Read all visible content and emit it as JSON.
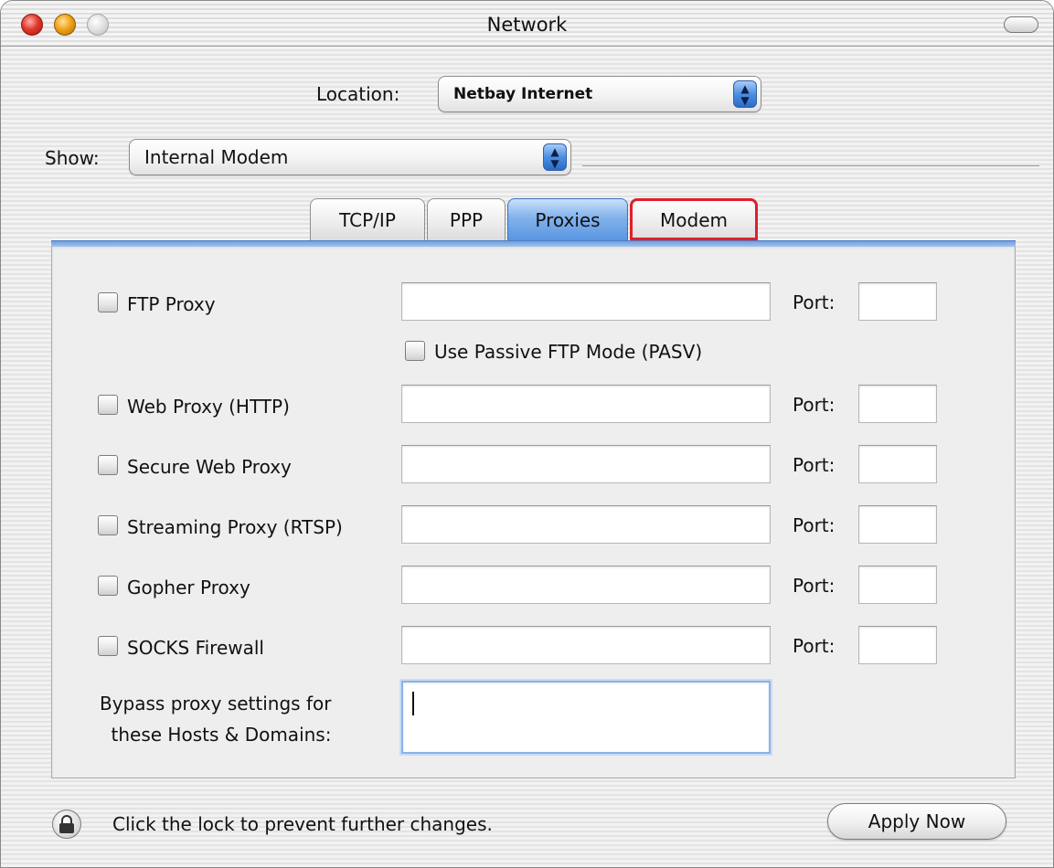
{
  "window": {
    "title": "Network"
  },
  "location": {
    "label": "Location:",
    "value": "Netbay Internet"
  },
  "show": {
    "label": "Show:",
    "value": "Internal Modem"
  },
  "tabs": [
    {
      "label": "TCP/IP",
      "active": false
    },
    {
      "label": "PPP",
      "active": false
    },
    {
      "label": "Proxies",
      "active": true
    },
    {
      "label": "Modem",
      "active": false,
      "highlighted": true
    }
  ],
  "proxies": {
    "port_label": "Port:",
    "passive_ftp_label": "Use Passive FTP Mode (PASV)",
    "rows": [
      {
        "label": "FTP Proxy",
        "checked": false,
        "server": "",
        "port": ""
      },
      {
        "label": "Web Proxy (HTTP)",
        "checked": false,
        "server": "",
        "port": ""
      },
      {
        "label": "Secure Web Proxy",
        "checked": false,
        "server": "",
        "port": ""
      },
      {
        "label": "Streaming Proxy (RTSP)",
        "checked": false,
        "server": "",
        "port": ""
      },
      {
        "label": "Gopher Proxy",
        "checked": false,
        "server": "",
        "port": ""
      },
      {
        "label": "SOCKS Firewall",
        "checked": false,
        "server": "",
        "port": ""
      }
    ],
    "bypass_label_line1": "Bypass proxy settings for",
    "bypass_label_line2": "these Hosts & Domains:",
    "bypass_value": ""
  },
  "footer": {
    "lock_text": "Click the lock to prevent further changes.",
    "apply_label": "Apply Now"
  },
  "colors": {
    "active_tab": "#5a96e2",
    "highlight_outline": "#e0202c"
  }
}
